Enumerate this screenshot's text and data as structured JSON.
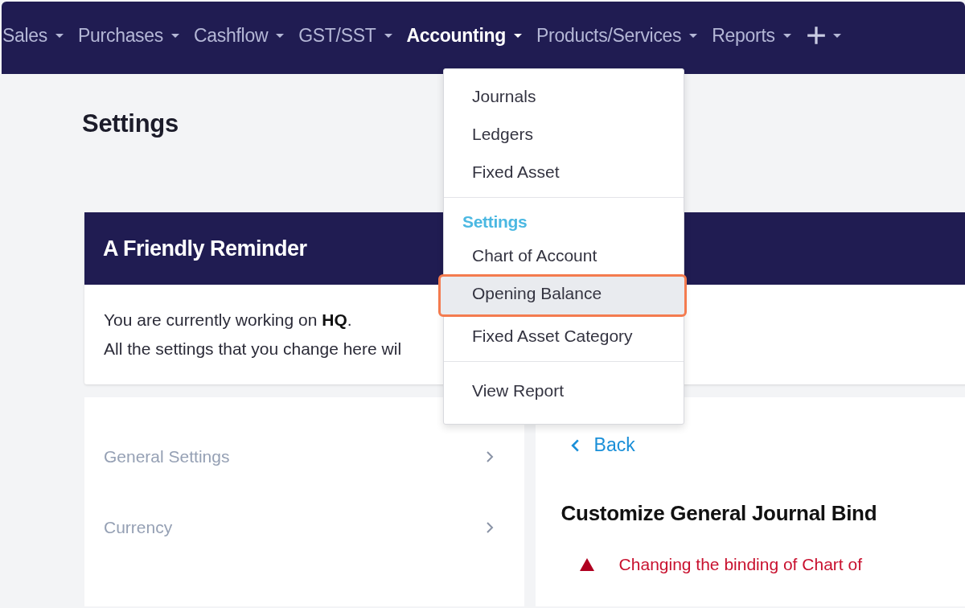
{
  "nav": {
    "items": [
      {
        "label": "Sales",
        "selected": false
      },
      {
        "label": "Purchases",
        "selected": false
      },
      {
        "label": "Cashflow",
        "selected": false
      },
      {
        "label": "GST/SST",
        "selected": false
      },
      {
        "label": "Accounting",
        "selected": true
      },
      {
        "label": "Products/Services",
        "selected": false
      },
      {
        "label": "Reports",
        "selected": false
      }
    ]
  },
  "page_title": "Settings",
  "reminder": {
    "title": "A Friendly Reminder",
    "lines": [
      "You are currently working on **HQ**.",
      "All the settings that you change here wil"
    ]
  },
  "settings_menu": {
    "items": [
      {
        "label": "General Settings"
      },
      {
        "label": "Currency"
      }
    ]
  },
  "detail": {
    "back": "Back",
    "title": "Customize General Journal Bind",
    "warning": "Changing the binding of Chart of"
  },
  "dropdown": {
    "groups": [
      {
        "items": [
          {
            "label": "Journals",
            "selected": false
          },
          {
            "label": "Ledgers",
            "selected": false
          },
          {
            "label": "Fixed Asset",
            "selected": false
          }
        ]
      },
      {
        "heading": "Settings",
        "items": [
          {
            "label": "Chart of Account",
            "selected": false
          },
          {
            "label": "Opening Balance",
            "selected": true
          },
          {
            "label": "Fixed Asset Category",
            "selected": false
          }
        ]
      },
      {
        "items": [
          {
            "label": "View Report",
            "selected": false
          }
        ]
      }
    ]
  }
}
